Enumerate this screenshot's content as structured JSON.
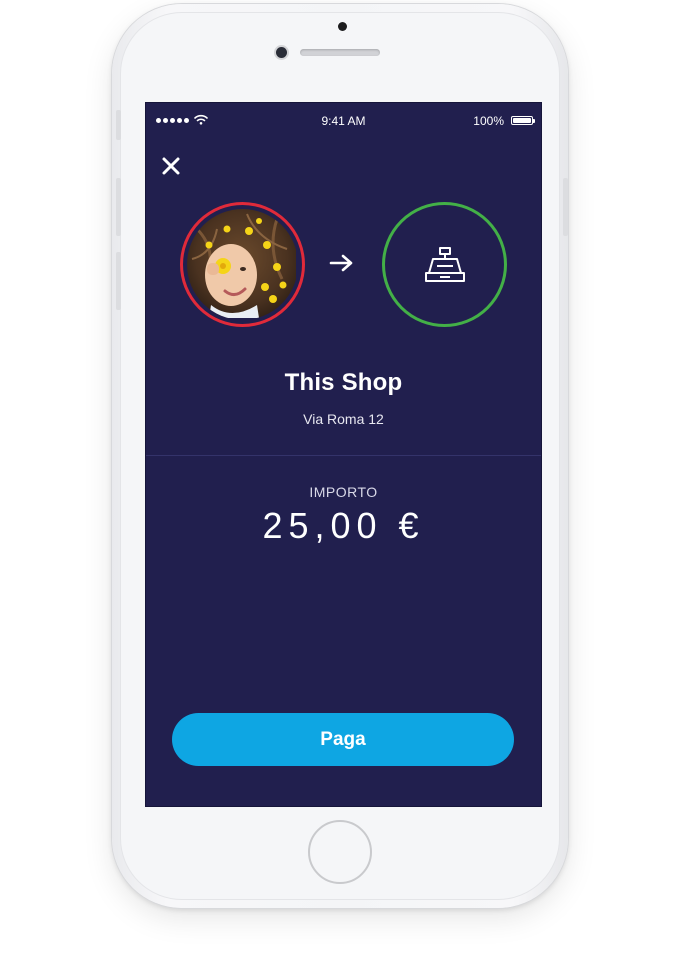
{
  "device": {
    "frame_color": "#f4f5f7"
  },
  "status_bar": {
    "time": "9:41 AM",
    "battery": "100%",
    "signal_dots": 5
  },
  "header": {
    "close_icon": "close-icon"
  },
  "payment": {
    "payer_avatar": "user-avatar-photo",
    "direction_icon": "arrow-right-icon",
    "merchant_icon": "cash-register-icon",
    "merchant_name": "This Shop",
    "merchant_address": "Via Roma 12",
    "amount_label": "IMPORTO",
    "amount": "25,00 €"
  },
  "actions": {
    "pay_label": "Paga"
  },
  "colors": {
    "screen_background": "#211f4e",
    "payer_ring": "#e02a3a",
    "merchant_ring": "#43b047",
    "pay_button": "#0ea6e3"
  }
}
